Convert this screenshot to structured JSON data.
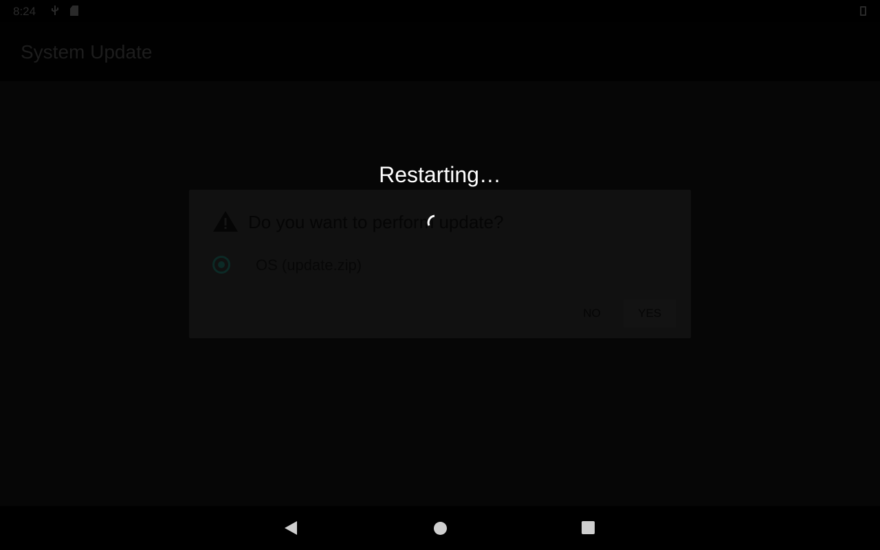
{
  "status_bar": {
    "time": "8:24",
    "icons": [
      "usb-icon",
      "sd-card-icon",
      "battery-icon"
    ]
  },
  "app_bar": {
    "title": "System Update"
  },
  "dialog": {
    "title": "Do you want to perform update?",
    "icon": "warning-icon",
    "option_label": "OS (update.zip)",
    "option_selected": true,
    "no_label": "NO",
    "yes_label": "YES"
  },
  "progress": {
    "message": "Restarting…"
  },
  "nav_bar": {
    "icons": [
      "back-icon",
      "home-icon",
      "recents-icon"
    ]
  },
  "colors": {
    "accent": "#0c2a26",
    "overlay_text": "#ffffff"
  }
}
